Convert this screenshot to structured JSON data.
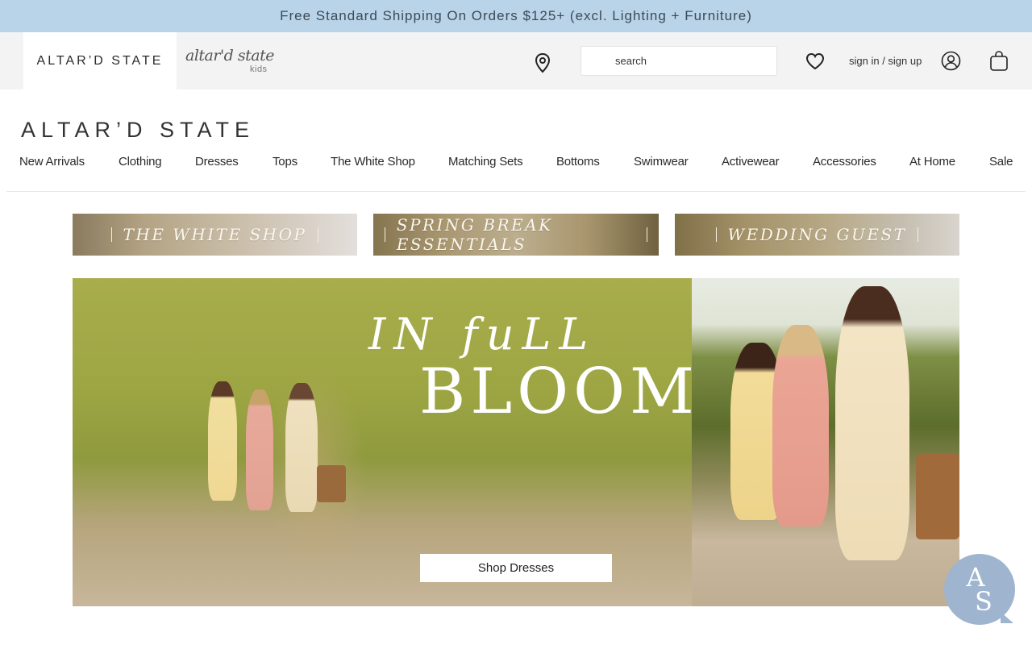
{
  "promo": {
    "text": "Free Standard Shipping On Orders $125+ (excl. Lighting + Furniture)"
  },
  "header": {
    "brand_tab": "ALTAR’D STATE",
    "kids_logo": {
      "script": "altar'd state",
      "sub": "kids"
    },
    "location_icon": "map-pin-icon",
    "search_placeholder": "search",
    "wishlist_icon": "heart-icon",
    "signin_label": "sign in / sign up",
    "account_icon": "user-icon",
    "cart_icon": "shopping-bag-icon"
  },
  "main_logo": "ALTAR’D STATE",
  "nav": {
    "items": [
      "New Arrivals",
      "Clothing",
      "Dresses",
      "Tops",
      "The White Shop",
      "Matching Sets",
      "Bottoms",
      "Swimwear",
      "Activewear",
      "Accessories",
      "At Home",
      "Sale"
    ]
  },
  "banners": [
    {
      "label": "THE WHITE SHOP"
    },
    {
      "label": "SPRING BREAK ESSENTIALS"
    },
    {
      "label": "WEDDING GUEST"
    }
  ],
  "hero": {
    "title_line1": "IN fuLL",
    "title_line2": "BLOOM",
    "cta": "Shop Dresses"
  },
  "chat": {
    "line1": "A",
    "line2": "S",
    "icon": "chat-logo-icon"
  },
  "colors": {
    "promo_bg": "#b9d3e8",
    "utility_bg": "#f3f3f3",
    "chat_bg": "#9fb4cf"
  }
}
